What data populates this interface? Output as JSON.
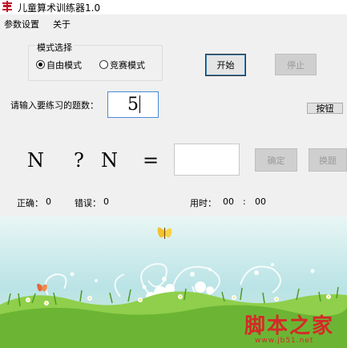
{
  "window": {
    "title": "儿童算术训练器1.0",
    "icon": "app-logo-icon"
  },
  "menu": {
    "items": [
      "参数设置",
      "关于"
    ]
  },
  "mode": {
    "group_label": "模式选择",
    "options": [
      {
        "label": "自由模式",
        "selected": true
      },
      {
        "label": "竞赛模式",
        "selected": false
      }
    ]
  },
  "buttons": {
    "start": "开始",
    "stop": "停止",
    "set": "按钮",
    "confirm": "确定",
    "change": "换题"
  },
  "count": {
    "label": "请输入要练习的题数：",
    "value": "5"
  },
  "equation": {
    "left": "N",
    "operator": "?",
    "right": "N",
    "equals": "=",
    "answer": ""
  },
  "status": {
    "correct_label": "正确：",
    "correct_value": "0",
    "wrong_label": "错误：",
    "wrong_value": "0",
    "time_label": "用时：",
    "minutes": "00",
    "sep": ":",
    "seconds": "00"
  },
  "watermark": {
    "text": "脚本之家",
    "url": "www.jb51.net"
  },
  "colors": {
    "accent": "#3c7fb1",
    "watermark": "#d62828",
    "sky": "#bfe6ea",
    "grass": "#7cc23b"
  }
}
